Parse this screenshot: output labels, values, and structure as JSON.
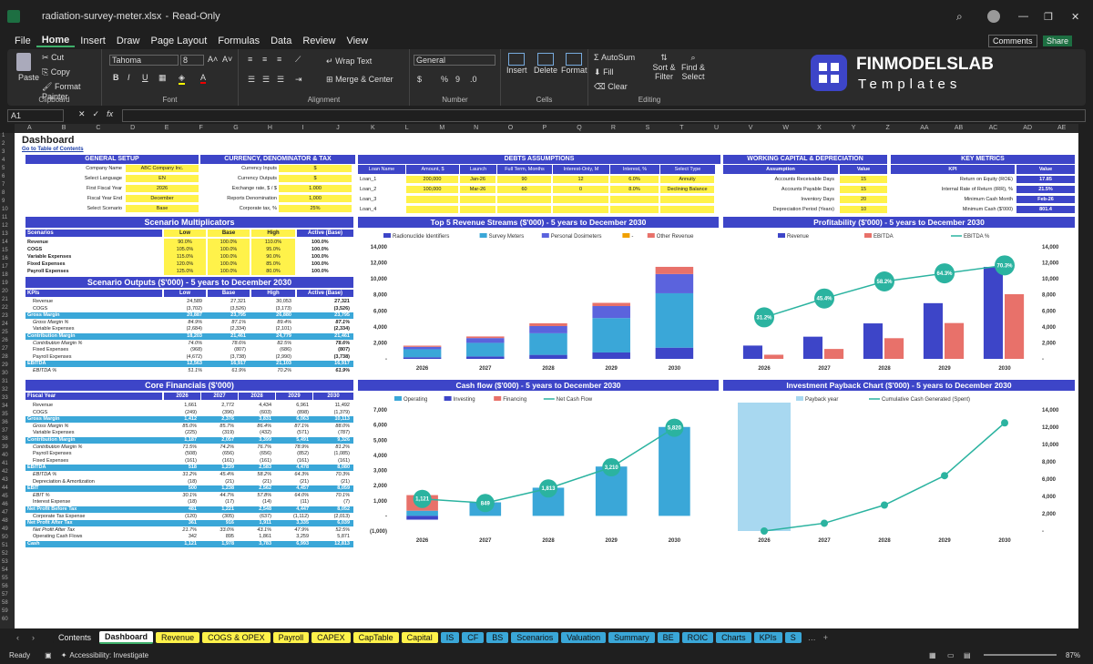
{
  "window": {
    "filename": "radiation-survey-meter.xlsx",
    "mode": "Read-Only",
    "comments": "Comments",
    "share": "Share"
  },
  "menu": [
    "File",
    "Home",
    "Insert",
    "Draw",
    "Page Layout",
    "Formulas",
    "Data",
    "Review",
    "View"
  ],
  "ribbon": {
    "paste": "Paste",
    "cut": "Cut",
    "copy": "Copy",
    "format_painter": "Format Painter",
    "clipboard": "Clipboard",
    "font_name": "Tahoma",
    "font_size": "8",
    "font": "Font",
    "wrap_text": "Wrap Text",
    "merge_center": "Merge & Center",
    "alignment": "Alignment",
    "number_format": "General",
    "number": "Number",
    "insert": "Insert",
    "delete": "Delete",
    "format": "Format",
    "cells": "Cells",
    "autosum": "AutoSum",
    "fill": "Fill",
    "clear": "Clear",
    "sort_filter": "Sort & Filter",
    "find_select": "Find & Select",
    "editing": "Editing"
  },
  "logo": {
    "brand": "FINMODELSLAB",
    "sub": "Templates"
  },
  "formula_bar": {
    "cell_ref": "A1",
    "formula": ""
  },
  "columns": [
    "A",
    "B",
    "C",
    "D",
    "E",
    "F",
    "G",
    "H",
    "I",
    "J",
    "K",
    "L",
    "M",
    "N",
    "O",
    "P",
    "Q",
    "R",
    "S",
    "T",
    "U",
    "V",
    "W",
    "X",
    "Y",
    "Z",
    "AA",
    "AB",
    "AC",
    "AD",
    "AE"
  ],
  "sheet": {
    "title": "Dashboard",
    "toc_link": "Go to Table of Contents",
    "general_setup": {
      "title": "GENERAL SETUP",
      "rows": [
        [
          "Company Name",
          "ABC Company Inc."
        ],
        [
          "Select Language",
          "EN"
        ],
        [
          "First Fiscal Year",
          "2026"
        ],
        [
          "Fiscal Year End",
          "December"
        ],
        [
          "Select Scenario",
          "Base"
        ]
      ]
    },
    "currency": {
      "title": "CURRENCY, DENOMINATOR & TAX",
      "rows": [
        [
          "Currency Inputs",
          "$"
        ],
        [
          "Currency Outputs",
          "$"
        ],
        [
          "Exchange rate, $ / $",
          "1.000"
        ],
        [
          "Reports Denomination",
          "1,000"
        ],
        [
          "Corporate tax, %",
          "25%"
        ]
      ]
    },
    "debts": {
      "title": "DEBTS ASSUMPTIONS",
      "headers": [
        "Loan Name",
        "Amount, $",
        "Launch",
        "Full Term, Months",
        "Interest-Only, M",
        "Interest, %",
        "Select Type"
      ],
      "rows": [
        [
          "Loan_1",
          "200,000",
          "Jan-26",
          "90",
          "12",
          "6.0%",
          "Annuity"
        ],
        [
          "Loan_2",
          "100,000",
          "Mar-26",
          "60",
          "0",
          "8.0%",
          "Declining Balance"
        ],
        [
          "Loan_3",
          "",
          "",
          "",
          "",
          "",
          ""
        ],
        [
          "Loan_4",
          "",
          "",
          "",
          "",
          "",
          ""
        ]
      ]
    },
    "working_capital": {
      "title": "WORKING CAPITAL & DEPRECIATION",
      "headers": [
        "Assumption",
        "Value"
      ],
      "rows": [
        [
          "Accounts Receivable Days",
          "15"
        ],
        [
          "Accounts Payable Days",
          "15"
        ],
        [
          "Inventory Days",
          "20"
        ],
        [
          "Depreciation Period (Years)",
          "10"
        ]
      ]
    },
    "kpis": {
      "title": "KEY METRICS",
      "headers": [
        "KPI",
        "Value"
      ],
      "rows": [
        [
          "Return on Equity (ROE)",
          "17.85"
        ],
        [
          "Internal Rate of Return (IRR), %",
          "21.5%"
        ],
        [
          "Minimum Cash Month",
          "Feb-26"
        ],
        [
          "Minimum Cash ($'000)",
          "801.4"
        ]
      ]
    },
    "multipliers": {
      "title": "Scenario Multiplicators",
      "headers": [
        "Scenarios",
        "Low",
        "Base",
        "High",
        "Active (Base)"
      ],
      "rows": [
        [
          "Revenue",
          "90.0%",
          "100.0%",
          "110.0%",
          "100.0%"
        ],
        [
          "COGS",
          "105.0%",
          "100.0%",
          "95.0%",
          "100.0%"
        ],
        [
          "Variable Expenses",
          "115.0%",
          "100.0%",
          "90.0%",
          "100.0%"
        ],
        [
          "Fixed Expenses",
          "120.0%",
          "100.0%",
          "85.0%",
          "100.0%"
        ],
        [
          "Payroll Expenses",
          "125.0%",
          "100.0%",
          "80.0%",
          "100.0%"
        ]
      ]
    },
    "scenario_outputs": {
      "title": "Scenario Outputs ($'000) - 5 years to December 2030",
      "headers": [
        "KPIs",
        "Low",
        "Base",
        "High",
        "Active (Base)"
      ],
      "rows": [
        [
          "Revenue",
          "24,589",
          "27,321",
          "30,053",
          "27,321",
          "n"
        ],
        [
          "COGS",
          "(3,702)",
          "(3,526)",
          "(3,173)",
          "(3,526)",
          "n"
        ],
        [
          "Gross Margin",
          "20,887",
          "23,795",
          "26,880",
          "23,795",
          "h"
        ],
        [
          "Gross Margin %",
          "84.9%",
          "87.1%",
          "89.4%",
          "87.1%",
          "i"
        ],
        [
          "Variable Expenses",
          "(2,684)",
          "(2,334)",
          "(2,101)",
          "(2,334)",
          "n"
        ],
        [
          "Contribution Margin",
          "18,203",
          "21,461",
          "24,779",
          "21,461",
          "h"
        ],
        [
          "Contribution Margin %",
          "74.0%",
          "78.6%",
          "82.5%",
          "78.6%",
          "i"
        ],
        [
          "Fixed Expenses",
          "(968)",
          "(807)",
          "(686)",
          "(807)",
          "n"
        ],
        [
          "Payroll Expenses",
          "(4,672)",
          "(3,738)",
          "(2,990)",
          "(3,738)",
          "n"
        ],
        [
          "EBITDA",
          "12,563",
          "16,917",
          "21,103",
          "16,917",
          "h"
        ],
        [
          "EBITDA %",
          "51.1%",
          "61.9%",
          "70.2%",
          "61.9%",
          "i"
        ]
      ]
    },
    "core": {
      "title": "Core Financials ($'000)",
      "headers": [
        "Fiscal Year",
        "2026",
        "2027",
        "2028",
        "2029",
        "2030"
      ],
      "rows": [
        [
          "Revenue",
          "1,661",
          "2,772",
          "4,434",
          "6,961",
          "11,492",
          "n"
        ],
        [
          "COGS",
          "(249)",
          "(396)",
          "(603)",
          "(898)",
          "(1,379)",
          "n"
        ],
        [
          "Gross Margin",
          "1,412",
          "2,376",
          "3,831",
          "6,063",
          "10,113",
          "h"
        ],
        [
          "Gross Margin %",
          "85.0%",
          "85.7%",
          "86.4%",
          "87.1%",
          "88.0%",
          "i"
        ],
        [
          "Variable Expenses",
          "(225)",
          "(319)",
          "(432)",
          "(571)",
          "(787)",
          "n"
        ],
        [
          "Contribution Margin",
          "1,187",
          "2,057",
          "3,399",
          "5,491",
          "9,326",
          "h"
        ],
        [
          "Contribution Margin %",
          "71.5%",
          "74.2%",
          "76.7%",
          "78.9%",
          "81.2%",
          "i"
        ],
        [
          "Payroll Expenses",
          "(508)",
          "(656)",
          "(656)",
          "(852)",
          "(1,085)",
          "n"
        ],
        [
          "Fixed Expenses",
          "(161)",
          "(161)",
          "(161)",
          "(161)",
          "(161)",
          "n"
        ],
        [
          "EBITDA",
          "518",
          "1,239",
          "2,583",
          "4,478",
          "8,080",
          "h"
        ],
        [
          "EBITDA %",
          "31.2%",
          "45.4%",
          "58.2%",
          "64.3%",
          "70.3%",
          "i"
        ],
        [
          "Depreciation & Amortization",
          "(18)",
          "(21)",
          "(21)",
          "(21)",
          "(21)",
          "n"
        ],
        [
          "EBIT",
          "500",
          "1,238",
          "2,562",
          "4,457",
          "8,059",
          "h"
        ],
        [
          "EBIT %",
          "30.1%",
          "44.7%",
          "57.8%",
          "64.0%",
          "70.1%",
          "i"
        ],
        [
          "Interest Expense",
          "(18)",
          "(17)",
          "(14)",
          "(11)",
          "(7)",
          "n"
        ],
        [
          "Net Profit Before Tax",
          "481",
          "1,221",
          "2,548",
          "4,447",
          "8,052",
          "h"
        ],
        [
          "Corporate Tax Expense",
          "(120)",
          "(305)",
          "(637)",
          "(1,112)",
          "(2,013)",
          "n"
        ],
        [
          "Net Profit After Tax",
          "361",
          "916",
          "1,911",
          "3,335",
          "6,039",
          "h"
        ],
        [
          "Net Profit After Tax",
          "21.7%",
          "33.0%",
          "43.1%",
          "47.9%",
          "52.5%",
          "i"
        ],
        [
          "Operating Cash Flows",
          "342",
          "895",
          "1,861",
          "3,259",
          "5,871",
          "n"
        ],
        [
          "Cash",
          "1,121",
          "1,978",
          "3,783",
          "6,993",
          "12,813",
          "h"
        ]
      ]
    }
  },
  "chart_data": [
    {
      "type": "bar",
      "title": "Top 5 Revenue Streams ($'000) - 5 years to December 2030",
      "categories": [
        "2026",
        "2027",
        "2028",
        "2029",
        "2030"
      ],
      "series": [
        {
          "name": "Radionuclide Identifiers",
          "values": [
            200,
            300,
            500,
            800,
            1400
          ],
          "color": "#3d45c8"
        },
        {
          "name": "Survey Meters",
          "values": [
            1000,
            1700,
            2700,
            4300,
            6800
          ],
          "color": "#3aa7d8"
        },
        {
          "name": "Personal Dosimeters",
          "values": [
            300,
            600,
            900,
            1500,
            2400
          ],
          "color": "#5b63dd"
        },
        {
          "name": "-",
          "values": [
            0,
            0,
            0,
            0,
            0
          ],
          "color": "#f0a000"
        },
        {
          "name": "Other Revenue",
          "values": [
            150,
            200,
            350,
            400,
            900
          ],
          "color": "#e8716a"
        }
      ],
      "ylim": [
        0,
        14000
      ],
      "yticks": [
        0,
        2000,
        4000,
        6000,
        8000,
        10000,
        12000,
        14000
      ],
      "ytick_labels": [
        "-",
        "2,000",
        "4,000",
        "6,000",
        "8,000",
        "10,000",
        "12,000",
        "14,000"
      ]
    },
    {
      "type": "bar",
      "title": "Profitability ($'000) - 5 years to December 2030",
      "categories": [
        "2026",
        "2027",
        "2028",
        "2029",
        "2030"
      ],
      "series": [
        {
          "name": "Revenue",
          "values": [
            1661,
            2772,
            4434,
            6961,
            11492
          ],
          "color": "#3d45c8"
        },
        {
          "name": "EBITDA",
          "values": [
            518,
            1239,
            2583,
            4478,
            8080
          ],
          "color": "#e8716a"
        },
        {
          "name": "EBITDA %",
          "values": [
            31.2,
            45.4,
            58.2,
            64.3,
            70.3
          ],
          "color": "#2bb3a0",
          "labels": [
            "31.2%",
            "45.4%",
            "58.2%",
            "64.3%",
            "70.3%"
          ]
        }
      ],
      "ylim": [
        0,
        14000
      ],
      "yticks": [
        0,
        2000,
        4000,
        6000,
        8000,
        10000,
        12000,
        14000
      ],
      "ytick_labels": [
        "-",
        "2,000",
        "4,000",
        "6,000",
        "8,000",
        "10,000",
        "12,000",
        "14,000"
      ]
    },
    {
      "type": "bar",
      "title": "Cash flow ($'000) - 5 years to December 2030",
      "categories": [
        "2026",
        "2027",
        "2028",
        "2029",
        "2030"
      ],
      "series": [
        {
          "name": "Operating",
          "values": [
            342,
            895,
            1861,
            3259,
            5871
          ],
          "color": "#3aa7d8"
        },
        {
          "name": "Investing",
          "values": [
            -250,
            0,
            0,
            0,
            0
          ],
          "color": "#3d45c8"
        },
        {
          "name": "Financing",
          "values": [
            1029,
            0,
            0,
            0,
            0
          ],
          "color": "#e8716a"
        },
        {
          "name": "Net Cash Flow",
          "values": [
            1121,
            849,
            1813,
            3210,
            5820
          ],
          "color": "#2bb3a0",
          "labels": [
            "1,121",
            "849",
            "1,813",
            "3,210",
            "5,820"
          ]
        }
      ],
      "ylim": [
        -1000,
        7000
      ],
      "yticks": [
        -1000,
        0,
        1000,
        2000,
        3000,
        4000,
        5000,
        6000,
        7000
      ],
      "ytick_labels": [
        "(1,000)",
        "-",
        "1,000",
        "2,000",
        "3,000",
        "4,000",
        "5,000",
        "6,000",
        "7,000"
      ]
    },
    {
      "type": "line",
      "title": "Investment Payback Chart ($'000) - 5 years to December 2030",
      "categories": [
        "2026",
        "2027",
        "2028",
        "2029",
        "2030"
      ],
      "series": [
        {
          "name": "Payback year",
          "values": [
            1,
            0,
            0,
            0,
            0
          ],
          "color": "#a8d8f0"
        },
        {
          "name": "Cumulative Cash Generated (Spent)",
          "values": [
            0,
            900,
            3000,
            6400,
            12500
          ],
          "color": "#2bb3a0"
        }
      ],
      "ylim": [
        0,
        14000
      ],
      "yticks": [
        0,
        2000,
        4000,
        6000,
        8000,
        10000,
        12000,
        14000
      ],
      "ytick_labels": [
        "-",
        "2,000",
        "4,000",
        "6,000",
        "8,000",
        "10,000",
        "12,000",
        "14,000"
      ]
    }
  ],
  "tabs": [
    {
      "name": "Contents",
      "color": "#1f1f1f",
      "text": "#eee"
    },
    {
      "name": "Dashboard",
      "color": "#ffffff",
      "text": "#111"
    },
    {
      "name": "Revenue",
      "color": "#fff24a",
      "text": "#111"
    },
    {
      "name": "COGS & OPEX",
      "color": "#fff24a",
      "text": "#111"
    },
    {
      "name": "Payroll",
      "color": "#fff24a",
      "text": "#111"
    },
    {
      "name": "CAPEX",
      "color": "#fff24a",
      "text": "#111"
    },
    {
      "name": "CapTable",
      "color": "#fff24a",
      "text": "#111"
    },
    {
      "name": "Capital",
      "color": "#fff24a",
      "text": "#111"
    },
    {
      "name": "IS",
      "color": "#3aa7d8",
      "text": "#111"
    },
    {
      "name": "CF",
      "color": "#3aa7d8",
      "text": "#111"
    },
    {
      "name": "BS",
      "color": "#3aa7d8",
      "text": "#111"
    },
    {
      "name": "Scenarios",
      "color": "#3aa7d8",
      "text": "#111"
    },
    {
      "name": "Valuation",
      "color": "#3aa7d8",
      "text": "#111"
    },
    {
      "name": "Summary",
      "color": "#3aa7d8",
      "text": "#111"
    },
    {
      "name": "BE",
      "color": "#3aa7d8",
      "text": "#111"
    },
    {
      "name": "ROIC",
      "color": "#3aa7d8",
      "text": "#111"
    },
    {
      "name": "Charts",
      "color": "#3aa7d8",
      "text": "#111"
    },
    {
      "name": "KPIs",
      "color": "#3aa7d8",
      "text": "#111"
    },
    {
      "name": "S",
      "color": "#3aa7d8",
      "text": "#111"
    }
  ],
  "status": {
    "ready": "Ready",
    "accessibility": "Accessibility: Investigate",
    "zoom": "87%"
  },
  "colors": {
    "accent": "#3d45c8",
    "input": "#fff24a",
    "highlight": "#3aa7d8",
    "teal": "#2bb3a0",
    "salmon": "#e8716a"
  }
}
